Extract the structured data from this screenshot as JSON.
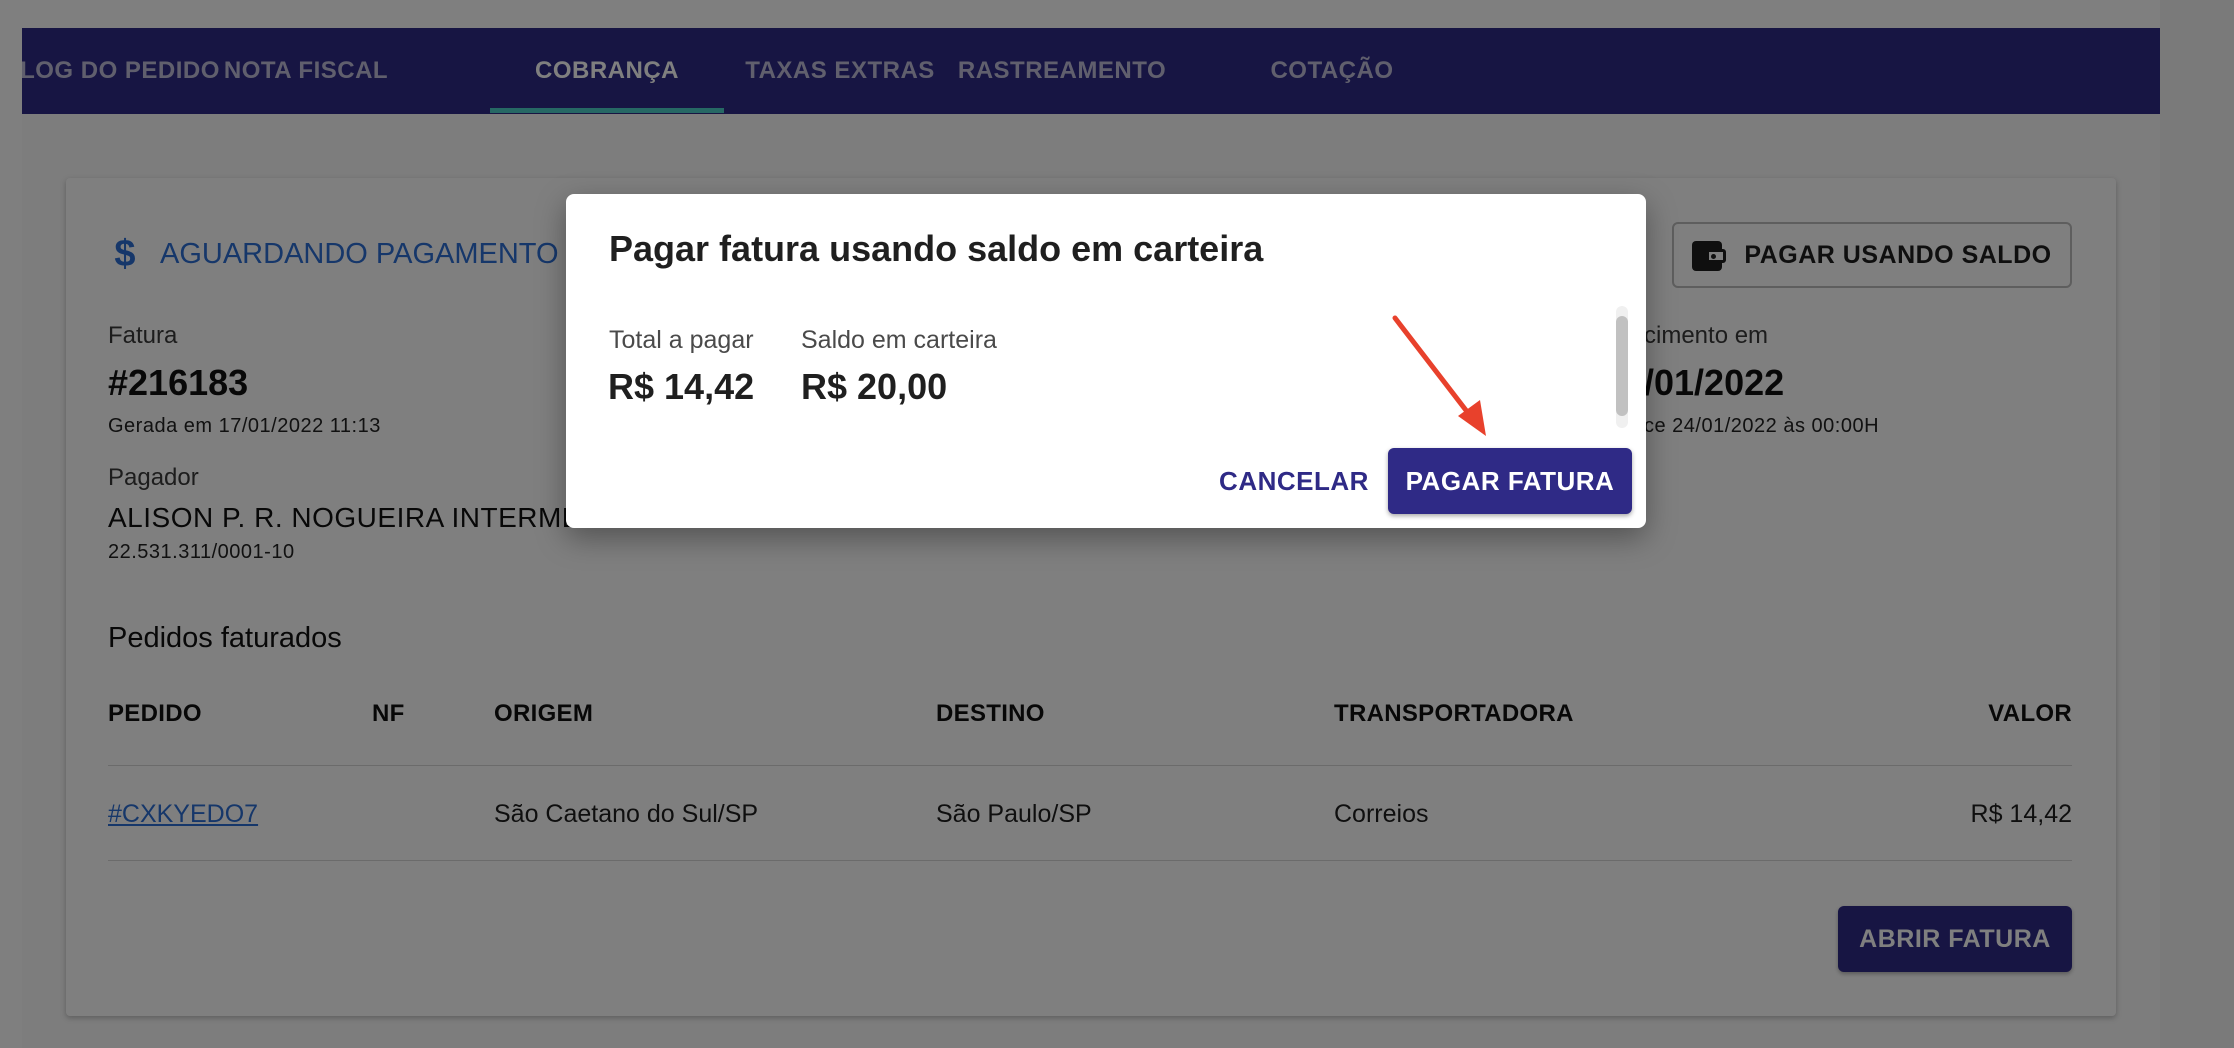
{
  "tabs": [
    {
      "label": "LOG DO PEDIDO"
    },
    {
      "label": "NOTA FISCAL"
    },
    {
      "label": "COBRANÇA",
      "active": true
    },
    {
      "label": "TAXAS EXTRAS"
    },
    {
      "label": "RASTREAMENTO"
    },
    {
      "label": "COTAÇÃO"
    }
  ],
  "invoice": {
    "status_icon": "dollar-icon",
    "status": "AGUARDANDO PAGAMENTO",
    "pay_balance_button": "PAGAR USANDO SALDO",
    "pay_balance_icon": "wallet-icon",
    "invoice_label": "Fatura",
    "invoice_number": "#216183",
    "generated": "Gerada em 17/01/2022 11:13",
    "due_label_partial": "cimento em",
    "due_value_partial": "/01/2022",
    "due_sub_partial": "ce 24/01/2022 às 00:00H",
    "payer_label": "Pagador",
    "payer_name_partial": "ALISON P. R. NOGUEIRA INTERMED",
    "payer_doc": "22.531.311/0001-10",
    "open_invoice_button": "ABRIR FATURA"
  },
  "orders": {
    "title": "Pedidos faturados",
    "columns": [
      "PEDIDO",
      "NF",
      "ORIGEM",
      "DESTINO",
      "TRANSPORTADORA",
      "VALOR"
    ],
    "rows": [
      {
        "pedido": "#CXKYEDO7",
        "nf": "",
        "origem": "São Caetano do Sul/SP",
        "destino": "São Paulo/SP",
        "transportadora": "Correios",
        "valor": "R$ 14,42"
      }
    ]
  },
  "dialog": {
    "title": "Pagar fatura usando saldo em carteira",
    "total_label": "Total a pagar",
    "total_value": "R$ 14,42",
    "balance_label": "Saldo em carteira",
    "balance_value": "R$ 20,00",
    "cancel_button": "CANCELAR",
    "pay_button": "PAGAR FATURA"
  },
  "colors": {
    "primary": "#2f2a86",
    "accent_indicator": "#4dd0c8",
    "link": "#2c6ed5",
    "annotation_arrow": "#e8412c"
  }
}
